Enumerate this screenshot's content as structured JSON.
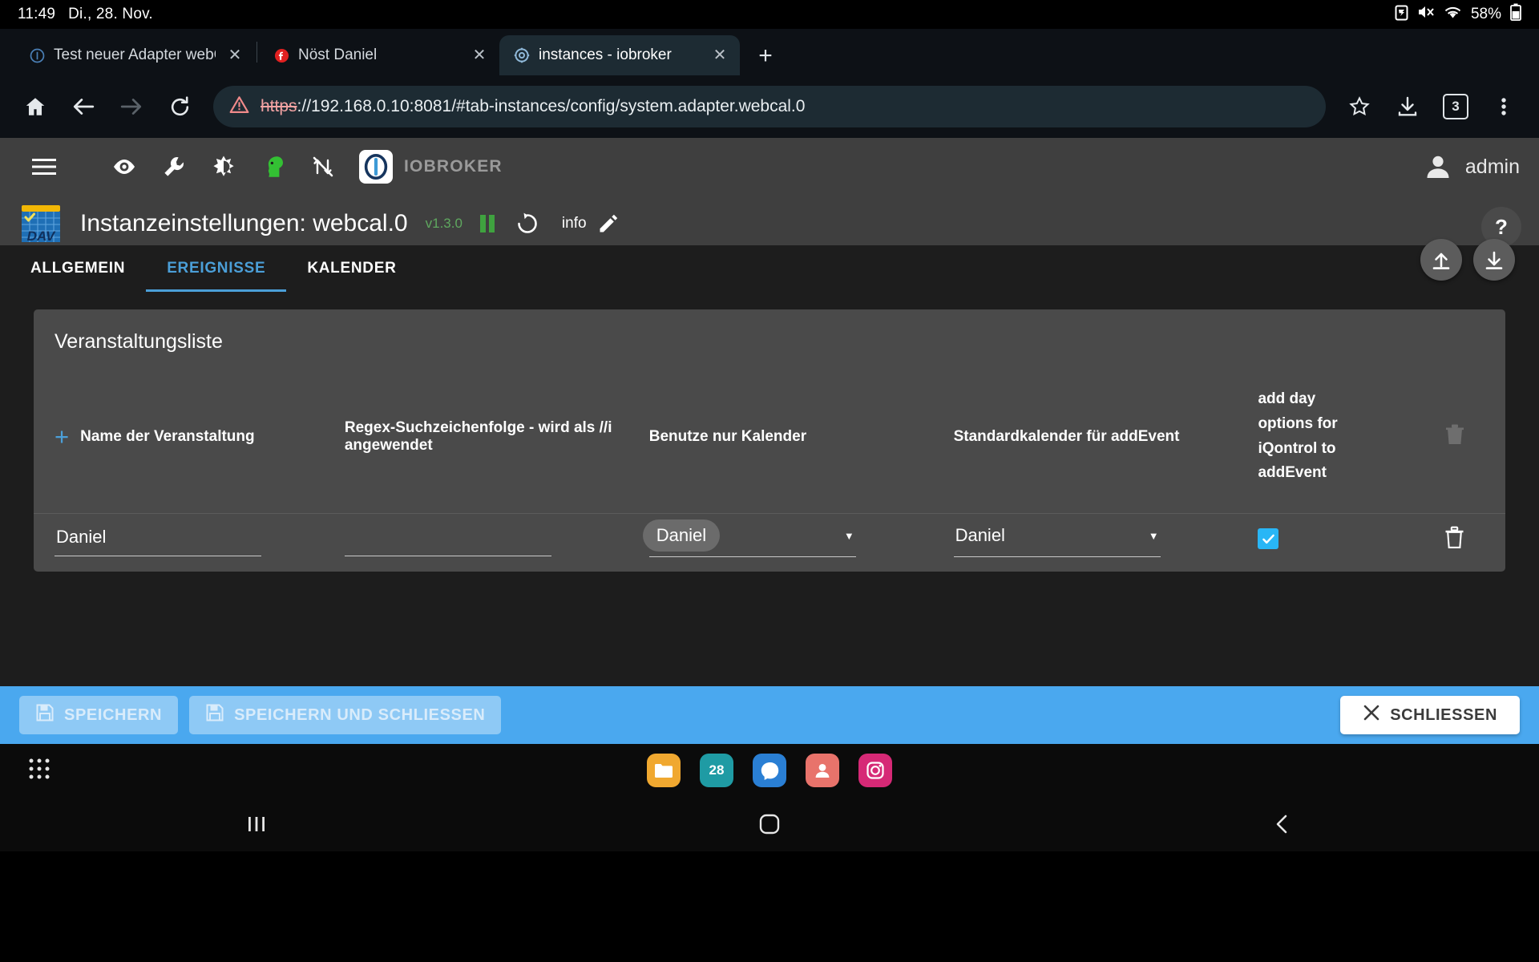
{
  "status_bar": {
    "time": "11:49",
    "date": "Di., 28. Nov.",
    "battery_percent": "58%",
    "icons": [
      "battery-saver-icon",
      "mute-icon",
      "wifi-icon",
      "battery-icon"
    ]
  },
  "browser": {
    "tabs": [
      {
        "title": "Test neuer Adapter webC",
        "favicon": "info-circle-icon",
        "active": false
      },
      {
        "title": "Nöst Daniel",
        "favicon": "facebook-icon",
        "active": false
      },
      {
        "title": "instances - iobroker",
        "favicon": "iobroker-gear-icon",
        "active": true
      }
    ],
    "new_tab_label": "+",
    "url_scheme": "https",
    "url_rest": "://192.168.0.10:8081/#tab-instances/config/system.adapter.webcal.0",
    "tab_count": "3",
    "toolbar_icons": [
      "home-icon",
      "back-icon",
      "forward-icon",
      "reload-icon",
      "insecure-warning-icon",
      "bookmark-star-icon",
      "download-icon",
      "tab-count-button",
      "overflow-menu-icon"
    ]
  },
  "appbar": {
    "icons": [
      "hamburger-menu-icon",
      "eye-icon",
      "wrench-icon",
      "contrast-icon",
      "expert-mode-head-icon",
      "no-sync-icon"
    ],
    "brand": "IOBROKER",
    "user": "admin"
  },
  "instance": {
    "title": "Instanzeinstellungen: webcal.0",
    "version": "v1.3.0",
    "icon": "webcal-dav-calendar-icon",
    "actions": [
      "pause-icon",
      "refresh-icon"
    ],
    "info_label": "info",
    "edit_icon": "pencil-icon",
    "help_label": "?"
  },
  "config_tabs": [
    {
      "label": "ALLGEMEIN",
      "active": false
    },
    {
      "label": "EREIGNISSE",
      "active": true
    },
    {
      "label": "KALENDER",
      "active": false
    }
  ],
  "fabs": [
    {
      "name": "upload-config-button",
      "icon": "upload-icon"
    },
    {
      "name": "download-config-button",
      "icon": "download-icon"
    }
  ],
  "panel": {
    "title": "Veranstaltungsliste",
    "columns": [
      "Name der Veranstaltung",
      "Regex-Suchzeichenfolge - wird als //i angewendet",
      "Benutze nur Kalender",
      "Standardkalender für addEvent",
      "add day options for iQontrol to addEvent",
      ""
    ],
    "add_icon": "plus-icon",
    "header_delete_icon": "trash-icon-disabled",
    "rows": [
      {
        "name": "Daniel",
        "regex": "",
        "only_calendar": "Daniel",
        "default_calendar": "Daniel",
        "add_day_options": true,
        "delete_icon": "trash-icon"
      }
    ]
  },
  "footer": {
    "save": "SPEICHERN",
    "save_close": "SPEICHERN UND SCHLIESSEN",
    "close": "SCHLIESSEN",
    "save_icon": "save-disk-icon",
    "close_icon": "x-icon"
  },
  "android_nav": {
    "apps_icon": "app-drawer-icon",
    "dock": [
      {
        "name": "files-app",
        "label": "",
        "color": "#f0a830"
      },
      {
        "name": "calendar-app",
        "label": "28",
        "color": "#1f9ba4"
      },
      {
        "name": "messenger-app",
        "label": "",
        "color": "#2a7fd4"
      },
      {
        "name": "contacts-app",
        "label": "",
        "color": "#e8736b"
      },
      {
        "name": "instagram-app",
        "label": "",
        "color": "#d62976"
      }
    ],
    "buttons": [
      "recents-icon",
      "home-icon",
      "back-icon"
    ]
  },
  "colors": {
    "accent_blue": "#4b9fd8",
    "footer_blue": "#4aa8ef",
    "checkbox_blue": "#29b6f6",
    "version_green": "#5fa85f",
    "panel_gray": "#4a4a4a"
  }
}
